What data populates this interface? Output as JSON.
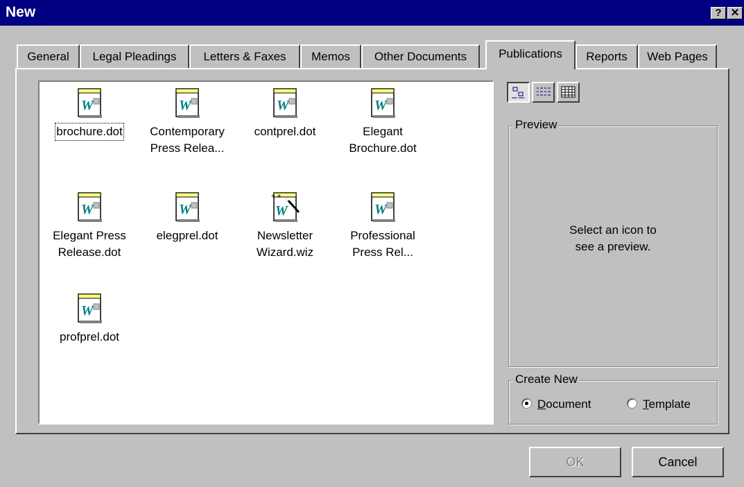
{
  "window": {
    "title": "New",
    "help_label": "?",
    "close_label": "✕"
  },
  "tabs": [
    {
      "label": "General"
    },
    {
      "label": "Legal Pleadings"
    },
    {
      "label": "Letters & Faxes"
    },
    {
      "label": "Memos"
    },
    {
      "label": "Other Documents"
    },
    {
      "label": "Publications",
      "active": true
    },
    {
      "label": "Reports"
    },
    {
      "label": "Web Pages"
    }
  ],
  "templates": [
    {
      "line1": "brochure.dot",
      "line2": "",
      "icon": "word-template-icon",
      "selected": true
    },
    {
      "line1": "Contemporary",
      "line2": "Press Relea...",
      "icon": "word-template-icon"
    },
    {
      "line1": "contprel.dot",
      "line2": "",
      "icon": "word-template-icon"
    },
    {
      "line1": "Elegant",
      "line2": "Brochure.dot",
      "icon": "word-template-icon"
    },
    {
      "line1": "Elegant Press",
      "line2": "Release.dot",
      "icon": "word-template-icon"
    },
    {
      "line1": "elegprel.dot",
      "line2": "",
      "icon": "word-template-icon"
    },
    {
      "line1": "Newsletter",
      "line2": "Wizard.wiz",
      "icon": "word-wizard-icon"
    },
    {
      "line1": "Professional",
      "line2": "Press Rel...",
      "icon": "word-template-icon"
    },
    {
      "line1": "profprel.dot",
      "line2": "",
      "icon": "word-template-icon"
    }
  ],
  "view_buttons": [
    {
      "icon": "large-icons-view-icon",
      "pressed": true
    },
    {
      "icon": "list-view-icon"
    },
    {
      "icon": "details-view-icon"
    }
  ],
  "preview": {
    "label": "Preview",
    "message_line1": "Select an icon to",
    "message_line2": "see a preview."
  },
  "create_new": {
    "label": "Create New",
    "document": {
      "mnemonic": "D",
      "rest": "ocument",
      "checked": true
    },
    "template": {
      "mnemonic": "T",
      "rest": "emplate",
      "checked": false
    }
  },
  "buttons": {
    "ok": "OK",
    "cancel": "Cancel"
  }
}
